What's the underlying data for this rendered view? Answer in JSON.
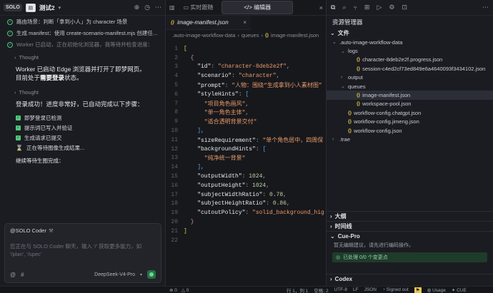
{
  "left": {
    "solo": "SOLO",
    "title": "测试2",
    "steps": [
      {
        "text": "路由场景：判断「拿到小人」为 character 场景"
      },
      {
        "text": "生成 manifest：使用 create-scenario-manifest.mjs 创建任..."
      },
      {
        "text": "Worker 已启动，正在初始化浏览器，我等待并检查进度："
      }
    ],
    "thought1": "Thought",
    "para1_a": "Worker 已启动 Edge 浏览器并打开了即梦网页。目前处于",
    "para1_b": "需要登录",
    "para1_c": "状态。",
    "thought2": "Thought",
    "para2": "登录成功！进度非常好，已自动完成以下步骤：",
    "checklist": [
      "即梦登录已检测",
      "提示词已写入并验证",
      "生成请求已提交"
    ],
    "pending": "正在等待图像生成结果...",
    "waiting": "继续等待生图完成：",
    "agent": "@SOLO Coder",
    "placeholder_1": "您正在与 SOLO Coder 聊天，输入 '/' 获取更多能力，如",
    "placeholder_2": "'/plan', '/spec'",
    "model": "DeepSeek-V4-Pro"
  },
  "editor": {
    "tab_preview": "实时跟随",
    "tab_editor": "编辑器",
    "file_tab": "image-manifest.json",
    "crumbs": [
      ".auto-image-workflow-data",
      "queues",
      "image-manifest.json"
    ],
    "lines": [
      {
        "n": "1",
        "html": "<span class=\"br\">[</span>"
      },
      {
        "n": "2",
        "html": "  <span class=\"br2\">{</span>"
      },
      {
        "n": "3",
        "html": "    <span class=\"key\">\"id\"</span><span class=\"p\">: </span><span class=\"s\">\"character-8deb2e2f\"</span><span class=\"p\">,</span>"
      },
      {
        "n": "4",
        "html": "    <span class=\"key\">\"scenario\"</span><span class=\"p\">: </span><span class=\"s\">\"character\"</span><span class=\"p\">,</span>"
      },
      {
        "n": "5",
        "html": "    <span class=\"key\">\"prompt\"</span><span class=\"p\">: </span><span class=\"s\">\"人物：围绕“生成拿到小人素材图”</span>"
      },
      {
        "n": "6",
        "html": "    <span class=\"key\">\"styleHints\"</span><span class=\"p\">: </span><span class=\"br3\">[</span>"
      },
      {
        "n": "7",
        "html": "      <span class=\"s\">\"项目角色画风\"</span><span class=\"p\">,</span>"
      },
      {
        "n": "8",
        "html": "      <span class=\"s\">\"单一角色主体\"</span><span class=\"p\">,</span>"
      },
      {
        "n": "9",
        "html": "      <span class=\"s\">\"适合透明背景交付\"</span>"
      },
      {
        "n": "10",
        "html": "    <span class=\"br3\">]</span><span class=\"p\">,</span>"
      },
      {
        "n": "11",
        "html": "    <span class=\"key\">\"sizeRequirement\"</span><span class=\"p\">: </span><span class=\"s\">\"单个角色居中，四周保</span>"
      },
      {
        "n": "12",
        "html": "    <span class=\"key\">\"backgroundHints\"</span><span class=\"p\">: </span><span class=\"br3\">[</span>"
      },
      {
        "n": "13",
        "html": "      <span class=\"s\">\"纯净统一背景\"</span>"
      },
      {
        "n": "14",
        "html": "    <span class=\"br3\">]</span><span class=\"p\">,</span>"
      },
      {
        "n": "15",
        "html": "    <span class=\"key\">\"outputWidth\"</span><span class=\"p\">: </span><span class=\"n\">1024</span><span class=\"p\">,</span>"
      },
      {
        "n": "16",
        "html": "    <span class=\"key\">\"outputHeight\"</span><span class=\"p\">: </span><span class=\"n\">1024</span><span class=\"p\">,</span>"
      },
      {
        "n": "17",
        "html": "    <span class=\"key\">\"subjectWidthRatio\"</span><span class=\"p\">: </span><span class=\"n\">0.78</span><span class=\"p\">,</span>"
      },
      {
        "n": "18",
        "html": "    <span class=\"key\">\"subjectHeightRatio\"</span><span class=\"p\">: </span><span class=\"n\">0.86</span><span class=\"p\">,</span>"
      },
      {
        "n": "19",
        "html": "    <span class=\"key\">\"cutoutPolicy\"</span><span class=\"p\">: </span><span class=\"s\">\"solid_background_hig</span>"
      },
      {
        "n": "20",
        "html": "  <span class=\"br2\">}</span>"
      },
      {
        "n": "21",
        "html": "<span class=\"br\">]</span>"
      },
      {
        "n": "22",
        "html": ""
      }
    ]
  },
  "explorer": {
    "header": "资源管理器",
    "files_label": "文件",
    "tree": [
      {
        "depth": 0,
        "type": "folder",
        "open": true,
        "name": ".auto-image-workflow-data"
      },
      {
        "depth": 1,
        "type": "folder",
        "open": true,
        "name": "logs"
      },
      {
        "depth": 2,
        "type": "file",
        "name": "character-8deb2e2f.progress.json"
      },
      {
        "depth": 2,
        "type": "file",
        "name": "session-c4ed2cf73ed849e6a4640093f3434102.json"
      },
      {
        "depth": 1,
        "type": "folder",
        "open": false,
        "name": "output"
      },
      {
        "depth": 1,
        "type": "folder",
        "open": true,
        "name": "queues"
      },
      {
        "depth": 2,
        "type": "file",
        "name": "image-manifest.json",
        "selected": true
      },
      {
        "depth": 2,
        "type": "file",
        "name": "workspace-pool.json"
      },
      {
        "depth": 1,
        "type": "file",
        "name": "workflow-config.chatgpt.json"
      },
      {
        "depth": 1,
        "type": "file",
        "name": "workflow-config.jimeng.json"
      },
      {
        "depth": 1,
        "type": "file",
        "name": "workflow-config.json"
      },
      {
        "depth": 0,
        "type": "folder",
        "open": false,
        "name": ".trae"
      }
    ],
    "outline": "大纲",
    "timeline": "时间线",
    "cue": "Cue-Pro",
    "cue_msg": "暂无编辑建议，请先进行编码操作。",
    "cue_done": "已处理 0/0 个变更点",
    "codex": "Codex"
  },
  "status": {
    "errors": "0",
    "warnings": "0",
    "position": "行 1，列 1",
    "spaces": "空格: 2",
    "encoding": "UTF-8",
    "eol": "LF",
    "lang": "JSON",
    "signed": "Signed out",
    "usage": "Usage",
    "cue": "CUE"
  },
  "colors": {
    "accent_green": "#4ec97c",
    "bg": "#17181c",
    "panel": "#1b1c21"
  }
}
